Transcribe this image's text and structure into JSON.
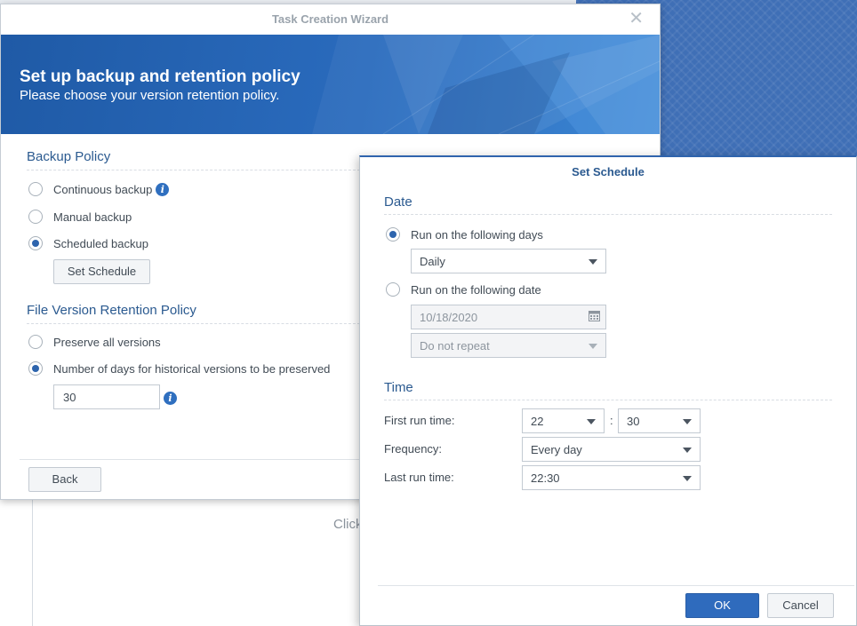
{
  "background": {
    "partial_text": "Click"
  },
  "wizard": {
    "title": "Task Creation Wizard",
    "banner_title": "Set up backup and retention policy",
    "banner_subtitle": "Please choose your version retention policy.",
    "backup_policy": {
      "heading": "Backup Policy",
      "options": [
        {
          "label": "Continuous backup",
          "checked": false
        },
        {
          "label": "Manual backup",
          "checked": false
        },
        {
          "label": "Scheduled backup",
          "checked": true
        }
      ],
      "set_schedule_label": "Set Schedule"
    },
    "retention": {
      "heading": "File Version Retention Policy",
      "options": [
        {
          "label": "Preserve all versions",
          "checked": false
        },
        {
          "label": "Number of days for historical versions to be preserved",
          "checked": true
        }
      ],
      "days_value": "30"
    },
    "back_label": "Back"
  },
  "schedule": {
    "title": "Set Schedule",
    "date_heading": "Date",
    "run_days_label": "Run on the following days",
    "days_select": "Daily",
    "run_date_label": "Run on the following date",
    "date_value": "10/18/2020",
    "repeat_select": "Do not repeat",
    "time_heading": "Time",
    "first_run_label": "First run time:",
    "first_run_hour": "22",
    "first_run_minute": "30",
    "time_separator": ":",
    "frequency_label": "Frequency:",
    "frequency_value": "Every day",
    "last_run_label": "Last run time:",
    "last_run_value": "22:30",
    "ok_label": "OK",
    "cancel_label": "Cancel"
  },
  "colors": {
    "accent": "#2f6bbd",
    "banner": "#2a6bbd",
    "heading": "#2b5a90"
  }
}
